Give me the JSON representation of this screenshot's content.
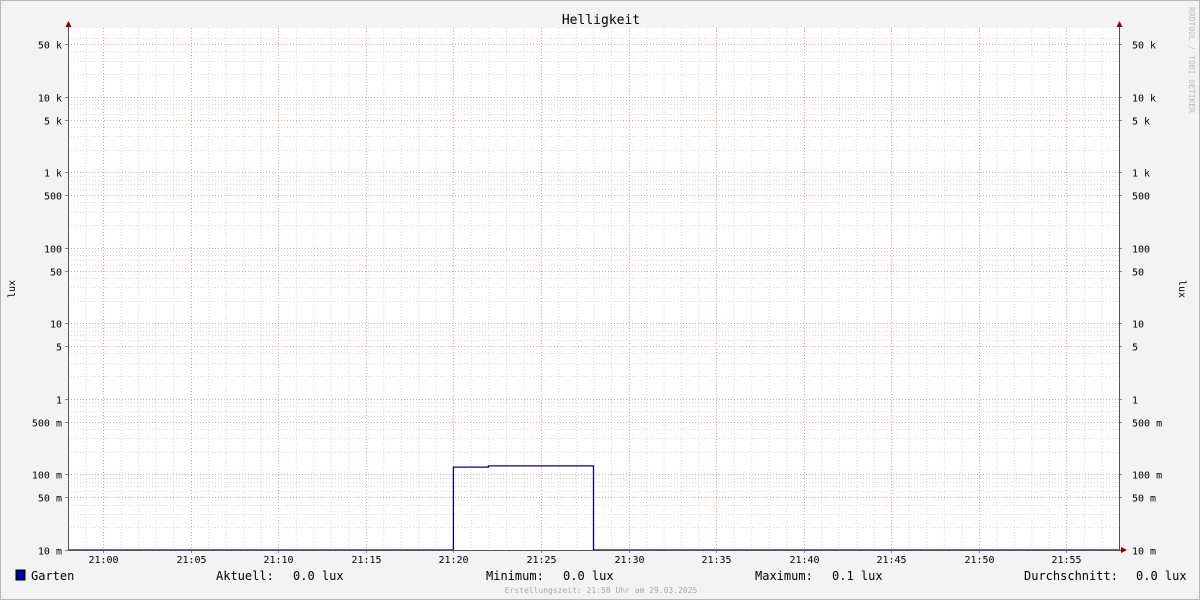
{
  "chart_data": {
    "type": "line",
    "title": "Helligkeit",
    "ylabel": "lux",
    "yscale": "log",
    "ylim": [
      0.01,
      60000
    ],
    "xlim": [
      "20:58",
      "21:58"
    ],
    "x_ticks": [
      "21:00",
      "21:05",
      "21:10",
      "21:15",
      "21:20",
      "21:25",
      "21:30",
      "21:35",
      "21:40",
      "21:45",
      "21:50",
      "21:55"
    ],
    "y_ticks": [
      {
        "value": 50000,
        "label": "50 k"
      },
      {
        "value": 10000,
        "label": "10 k"
      },
      {
        "value": 5000,
        "label": "5 k"
      },
      {
        "value": 1000,
        "label": "1 k"
      },
      {
        "value": 500,
        "label": "500"
      },
      {
        "value": 100,
        "label": "100"
      },
      {
        "value": 50,
        "label": "50"
      },
      {
        "value": 10,
        "label": "10"
      },
      {
        "value": 5,
        "label": "5"
      },
      {
        "value": 1,
        "label": "1"
      },
      {
        "value": 0.5,
        "label": "500 m"
      },
      {
        "value": 0.1,
        "label": "100 m"
      },
      {
        "value": 0.05,
        "label": "50 m"
      },
      {
        "value": 0.01,
        "label": "10 m"
      }
    ],
    "series": [
      {
        "name": "Garten",
        "color": "#00008b",
        "points": [
          {
            "x": "20:58",
            "y": 0.01
          },
          {
            "x": "21:20",
            "y": 0.01
          },
          {
            "x": "21:20",
            "y": 0.125
          },
          {
            "x": "21:22",
            "y": 0.125
          },
          {
            "x": "21:22",
            "y": 0.13
          },
          {
            "x": "21:28",
            "y": 0.13
          },
          {
            "x": "21:28",
            "y": 0.01
          },
          {
            "x": "21:58",
            "y": 0.01
          }
        ]
      }
    ],
    "grid": true,
    "legend": {
      "entry": "Garten",
      "color": "#000099",
      "stats": [
        {
          "label": "Aktuell:",
          "value": "0.0 lux"
        },
        {
          "label": "Minimum:",
          "value": "0.0 lux"
        },
        {
          "label": "Maximum:",
          "value": "0.1 lux"
        },
        {
          "label": "Durchschnitt:",
          "value": "0.0 lux"
        }
      ]
    },
    "footer": "Erstellungszeit: 21:58 Uhr am 29.03.2025",
    "watermark": "RRDTOOL / TOBI OETIKER"
  }
}
